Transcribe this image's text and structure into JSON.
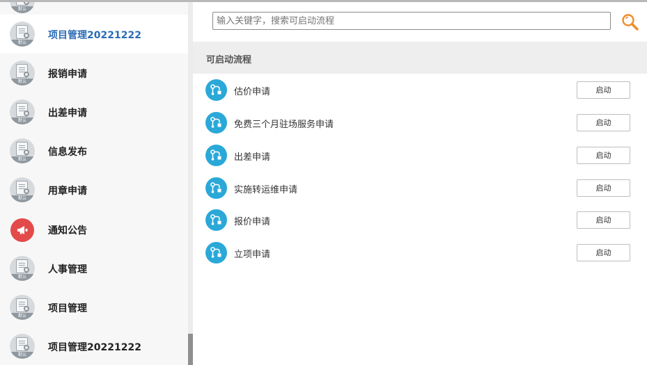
{
  "sidebar": {
    "items": [
      {
        "label": "",
        "icon": "form-doc-icon",
        "badge": "默认",
        "active": false
      },
      {
        "label": "项目管理20221222",
        "icon": "form-doc-icon",
        "badge": "默认",
        "active": true
      },
      {
        "label": "报销申请",
        "icon": "form-doc-icon",
        "badge": "默认",
        "active": false
      },
      {
        "label": "出差申请",
        "icon": "form-doc-icon",
        "badge": "默认",
        "active": false
      },
      {
        "label": "信息发布",
        "icon": "form-doc-icon",
        "badge": "默认",
        "active": false
      },
      {
        "label": "用章申请",
        "icon": "form-doc-icon",
        "badge": "默认",
        "active": false
      },
      {
        "label": "通知公告",
        "icon": "megaphone-icon",
        "badge": "",
        "active": false
      },
      {
        "label": "人事管理",
        "icon": "form-doc-icon",
        "badge": "默认",
        "active": false
      },
      {
        "label": "项目管理",
        "icon": "form-doc-icon",
        "badge": "默认",
        "active": false
      },
      {
        "label": "项目管理20221222",
        "icon": "form-doc-icon",
        "badge": "默认",
        "active": false
      }
    ]
  },
  "search": {
    "placeholder": "输入关键字，搜索可启动流程",
    "icon": "search-icon",
    "icon_color": "#f08a24"
  },
  "section": {
    "title": "可启动流程"
  },
  "flows": [
    {
      "name": "估价申请",
      "button": "启动"
    },
    {
      "name": "免费三个月驻场服务申请",
      "button": "启动"
    },
    {
      "name": "出差申请",
      "button": "启动"
    },
    {
      "name": "实施转运维申请",
      "button": "启动"
    },
    {
      "name": "报价申请",
      "button": "启动"
    },
    {
      "name": "立项申请",
      "button": "启动"
    }
  ],
  "colors": {
    "accent": "#2b6cb6",
    "flow_icon": "#2aa8d8",
    "notice_icon": "#e34a4a"
  }
}
